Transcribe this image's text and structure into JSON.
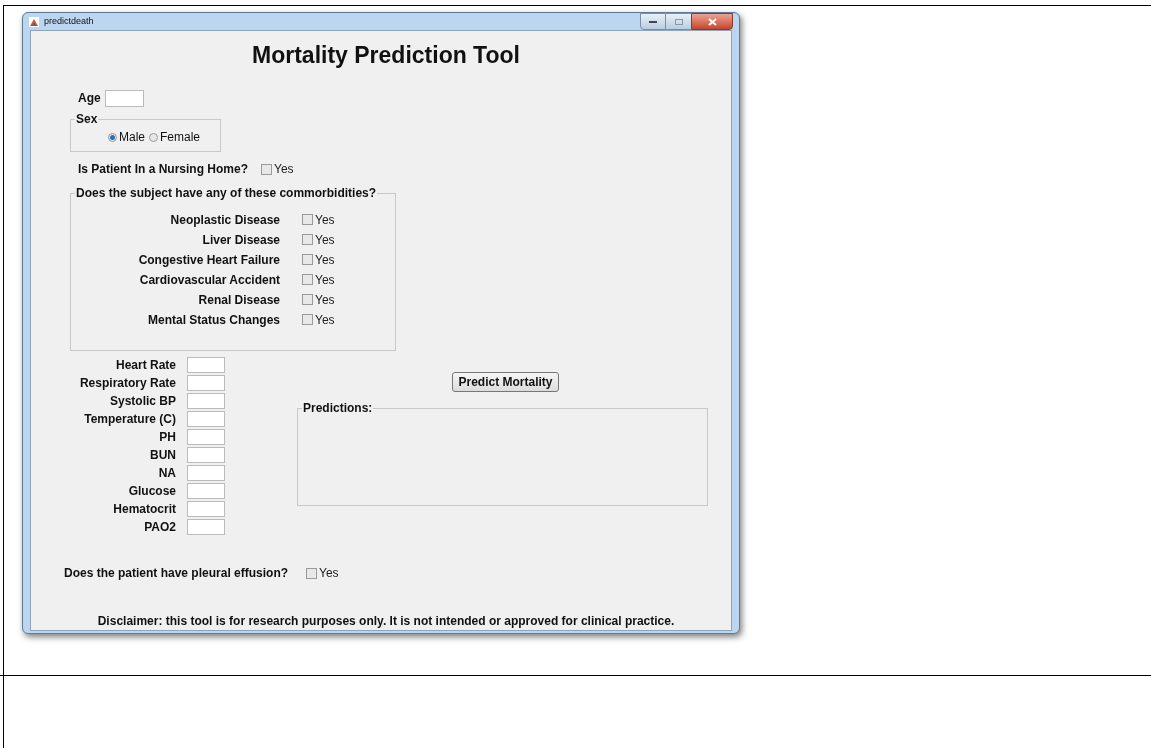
{
  "window": {
    "title": "predictdeath"
  },
  "heading": "Mortality Prediction Tool",
  "age": {
    "label": "Age"
  },
  "sex": {
    "legend": "Sex",
    "options": [
      {
        "label": "Male",
        "selected": true
      },
      {
        "label": "Female",
        "selected": false
      }
    ]
  },
  "nursing_home": {
    "label": "Is Patient In a Nursing Home?",
    "option": "Yes",
    "checked": false
  },
  "comorbidities": {
    "legend": "Does the subject have any of these commorbidities?",
    "items": [
      {
        "label": "Neoplastic Disease",
        "option": "Yes",
        "checked": false
      },
      {
        "label": "Liver Disease",
        "option": "Yes",
        "checked": false
      },
      {
        "label": "Congestive Heart Failure",
        "option": "Yes",
        "checked": false
      },
      {
        "label": "Cardiovascular Accident",
        "option": "Yes",
        "checked": false
      },
      {
        "label": "Renal Disease",
        "option": "Yes",
        "checked": false
      },
      {
        "label": "Mental Status Changes",
        "option": "Yes",
        "checked": false
      }
    ]
  },
  "vitals": [
    {
      "label": "Heart Rate"
    },
    {
      "label": "Respiratory Rate"
    },
    {
      "label": "Systolic BP"
    },
    {
      "label": "Temperature (C)"
    },
    {
      "label": "PH"
    },
    {
      "label": "BUN"
    },
    {
      "label": "NA"
    },
    {
      "label": "Glucose"
    },
    {
      "label": "Hematocrit"
    },
    {
      "label": "PAO2"
    }
  ],
  "predict_button": "Predict Mortality",
  "predictions": {
    "legend": "Predictions:"
  },
  "pleural_effusion": {
    "label": "Does the patient have pleural effusion?",
    "option": "Yes",
    "checked": false
  },
  "disclaimer": "Disclaimer: this tool is for research purposes only. It is not intended or approved for clinical practice."
}
